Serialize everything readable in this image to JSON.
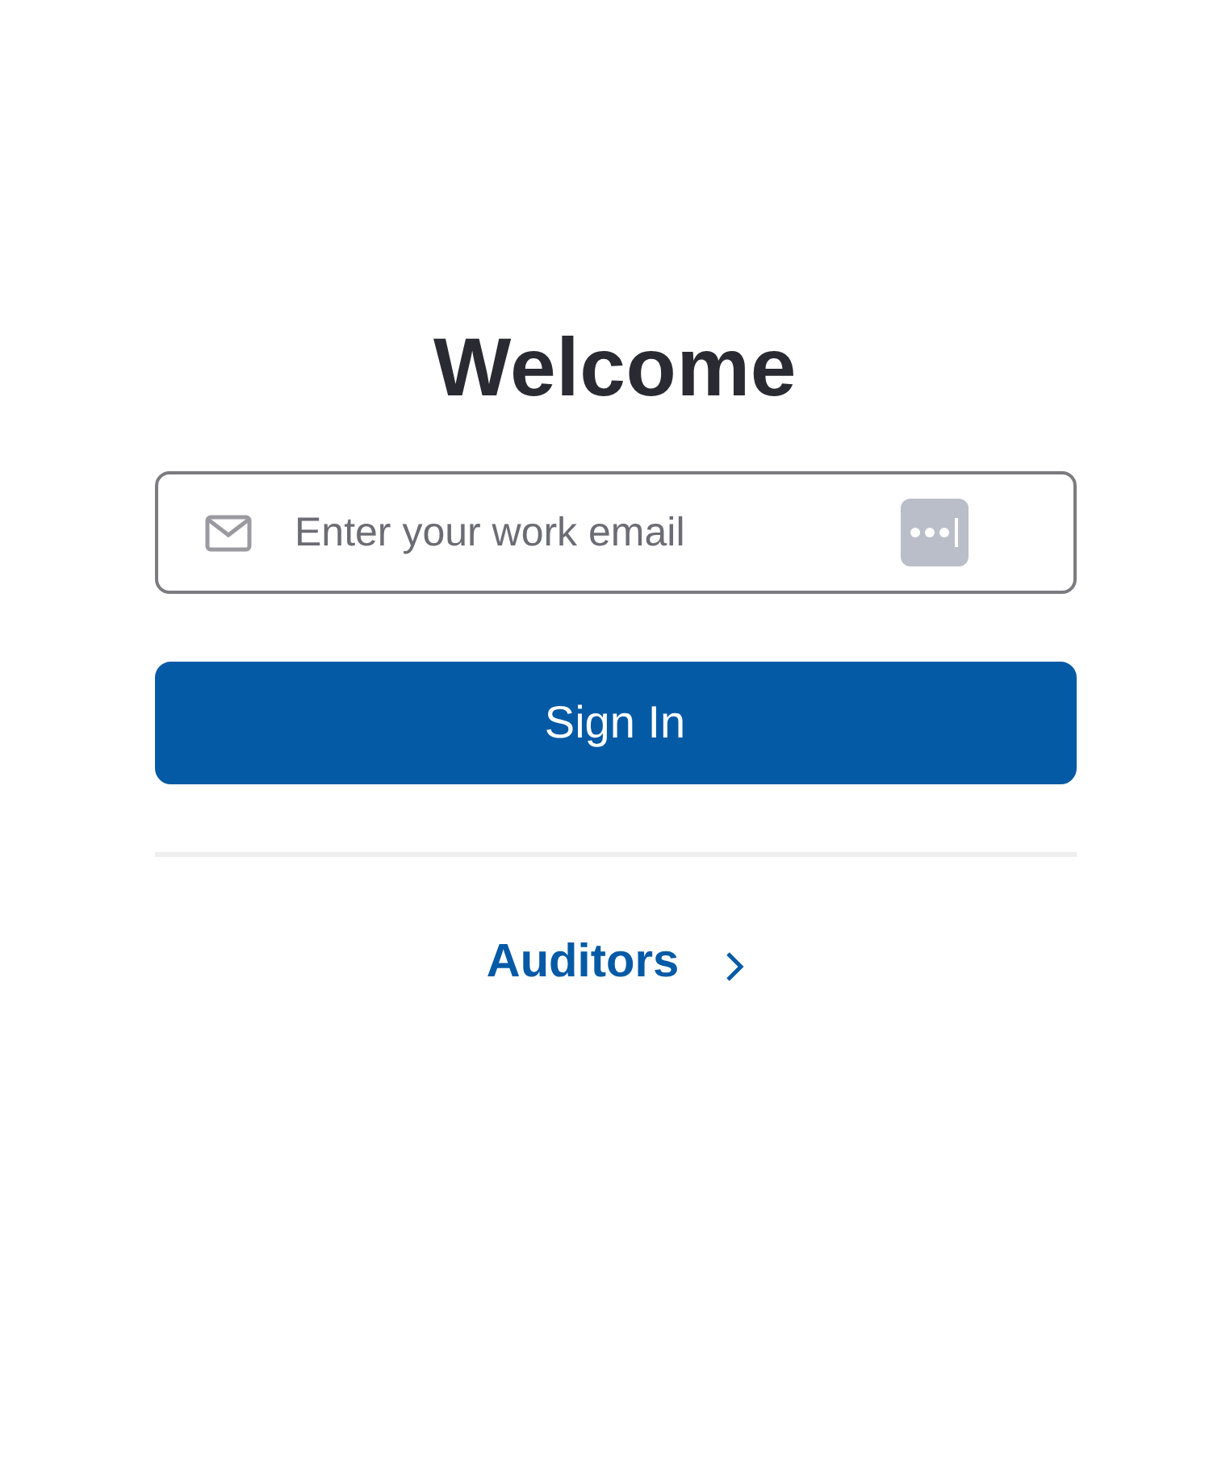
{
  "title": "Welcome",
  "email_field": {
    "placeholder": "Enter your work email"
  },
  "sign_in_button": {
    "label": "Sign In"
  },
  "auditors_link": {
    "label": "Auditors"
  }
}
